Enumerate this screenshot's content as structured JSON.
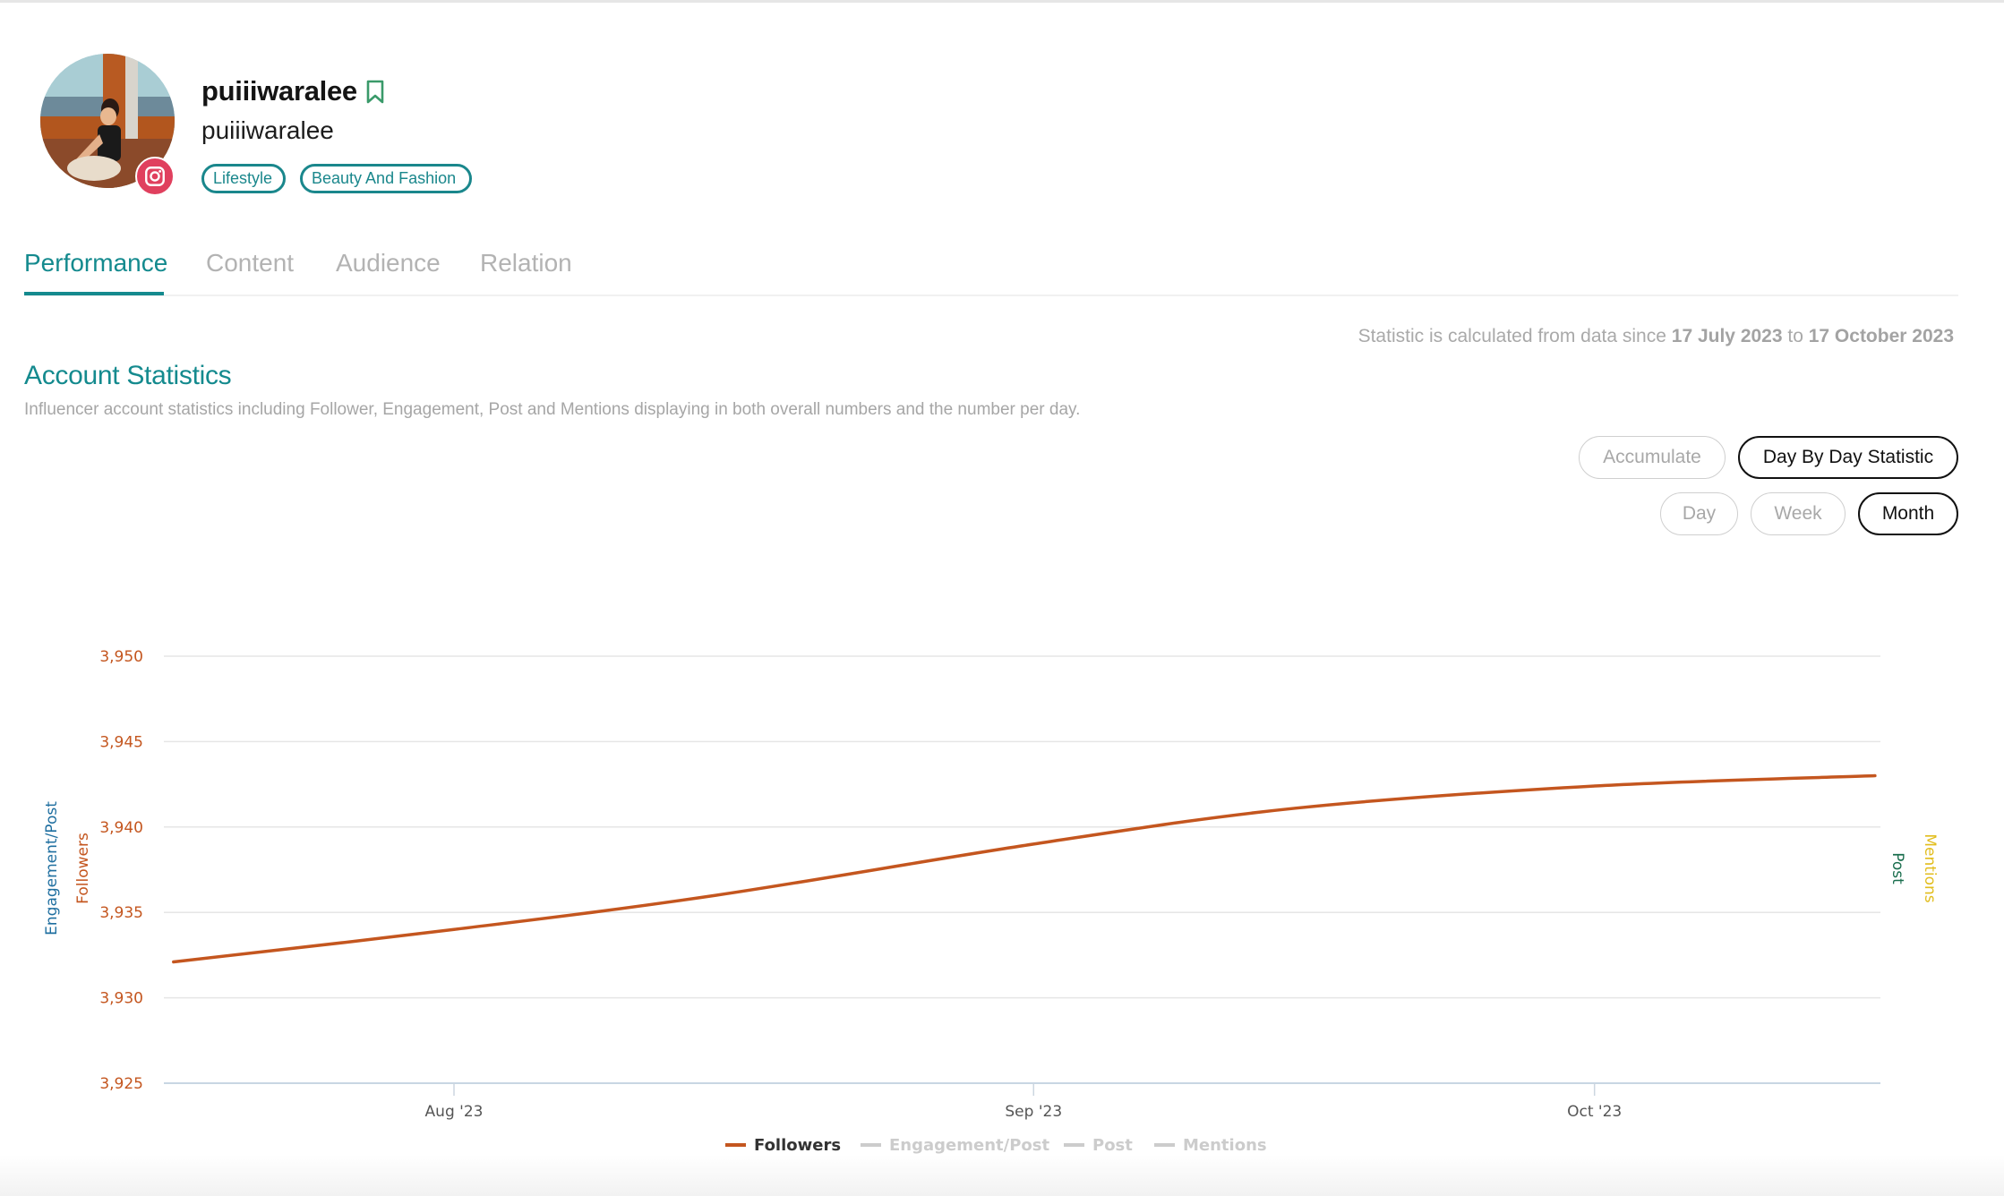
{
  "profile": {
    "display_name": "puiiiwaralee",
    "handle": "puiiiwaralee",
    "platform_icon": "instagram-icon",
    "bookmark_icon": "bookmark-icon",
    "tags": [
      "Lifestyle",
      "Beauty And Fashion"
    ]
  },
  "tabs": [
    {
      "label": "Performance",
      "active": true
    },
    {
      "label": "Content",
      "active": false
    },
    {
      "label": "Audience",
      "active": false
    },
    {
      "label": "Relation",
      "active": false
    }
  ],
  "section": {
    "title": "Account Statistics",
    "description": "Influencer account statistics including Follower, Engagement, Post and Mentions displaying in both overall numbers and the number per day.",
    "range_prefix": "Statistic is calculated from data since",
    "range_start": "17 July 2023",
    "range_joiner": "to",
    "range_end": "17 October 2023"
  },
  "mode_buttons": [
    {
      "label": "Accumulate",
      "active": false
    },
    {
      "label": "Day By Day Statistic",
      "active": true
    }
  ],
  "period_buttons": [
    {
      "label": "Day",
      "active": false
    },
    {
      "label": "Week",
      "active": false
    },
    {
      "label": "Month",
      "active": true
    }
  ],
  "colors": {
    "accent": "#148a8e",
    "followers": "#c4561f",
    "engagement_post": "#1f6fa0",
    "post": "#1a6e4e",
    "mentions": "#e2bd1d",
    "legend_inactive": "#cccccc",
    "instagram": "#e0405e",
    "bookmark": "#3a9a6a"
  },
  "chart_data": {
    "type": "line",
    "title": "",
    "x_type": "datetime",
    "x_ticks": [
      "Aug '23",
      "Sep '23",
      "Oct '23"
    ],
    "y_axes": {
      "left_primary": {
        "title": "Followers",
        "ticks": [
          "3,925",
          "3,930",
          "3,935",
          "3,940",
          "3,945",
          "3,950"
        ],
        "range": [
          3925,
          3950
        ]
      },
      "left_secondary": {
        "title": "Engagement/Post"
      },
      "right_primary": {
        "title": "Post"
      },
      "right_secondary": {
        "title": "Mentions"
      }
    },
    "grid": true,
    "legend_position": "bottom-center",
    "series": [
      {
        "name": "Followers",
        "visible": true,
        "points": [
          {
            "date": "2023-07-17",
            "value": 3932.1
          },
          {
            "date": "2023-08-01",
            "value": 3934.0
          },
          {
            "date": "2023-08-15",
            "value": 3936.0
          },
          {
            "date": "2023-09-01",
            "value": 3939.0
          },
          {
            "date": "2023-09-15",
            "value": 3941.1
          },
          {
            "date": "2023-10-01",
            "value": 3942.4
          },
          {
            "date": "2023-10-16",
            "value": 3943.0
          }
        ]
      },
      {
        "name": "Engagement/Post",
        "visible": false,
        "points": []
      },
      {
        "name": "Post",
        "visible": false,
        "points": []
      },
      {
        "name": "Mentions",
        "visible": false,
        "points": []
      }
    ]
  }
}
